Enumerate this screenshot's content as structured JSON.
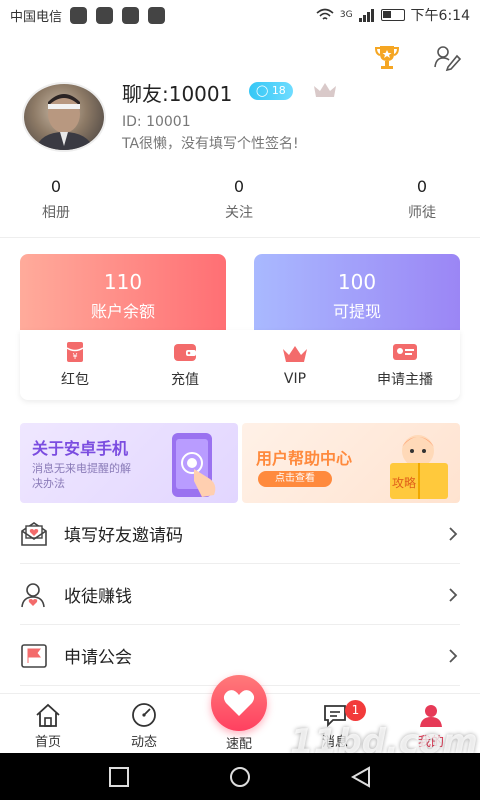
{
  "status_bar": {
    "carrier": "中国电信",
    "network": "3G",
    "time": "下午6:14"
  },
  "profile": {
    "nickname": "聊友:10001",
    "level": "18",
    "id_text": "ID: 10001",
    "signature": "TA很懒，没有填写个性签名!"
  },
  "stats": [
    {
      "value": "0",
      "label": "相册"
    },
    {
      "value": "0",
      "label": "关注"
    },
    {
      "value": "0",
      "label": "师徒"
    }
  ],
  "wallet": {
    "balance": {
      "value": "110",
      "label": "账户余额"
    },
    "withdrawable": {
      "value": "100",
      "label": "可提现"
    }
  },
  "actions": [
    {
      "label": "红包",
      "icon": "red-packet-icon"
    },
    {
      "label": "充值",
      "icon": "wallet-icon"
    },
    {
      "label": "VIP",
      "icon": "crown-icon"
    },
    {
      "label": "申请主播",
      "icon": "id-card-icon"
    }
  ],
  "banners": {
    "android": {
      "title": "关于安卓手机",
      "subtitle": "消息无来电提醒的解决办法"
    },
    "help": {
      "title": "用户帮助中心",
      "button": "点击查看",
      "book_text": "攻略"
    }
  },
  "menu": [
    {
      "label": "填写好友邀请码",
      "icon": "envelope-heart-icon"
    },
    {
      "label": "收徒赚钱",
      "icon": "user-heart-icon"
    },
    {
      "label": "申请公会",
      "icon": "flag-icon"
    }
  ],
  "tabs": [
    {
      "label": "首页",
      "icon": "home-icon"
    },
    {
      "label": "动态",
      "icon": "dashboard-icon"
    },
    {
      "label": "速配",
      "icon": "heart-icon"
    },
    {
      "label": "消息",
      "icon": "message-icon",
      "badge": "1"
    },
    {
      "label": "我的",
      "icon": "profile-icon",
      "active": true
    }
  ],
  "watermark": {
    "text": "11bd.com",
    "sub": "下载站"
  },
  "colors": {
    "accent": "#e63a57",
    "badge": "#f23b3b",
    "level": "#35c7f5"
  }
}
